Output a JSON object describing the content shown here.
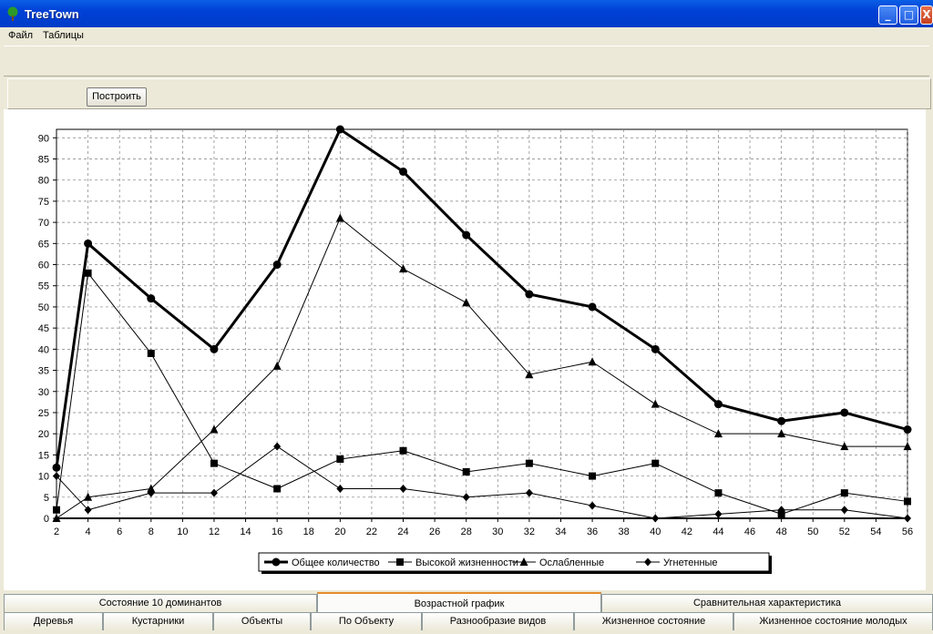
{
  "window": {
    "title": "TreeTown"
  },
  "menu": [
    "Файл",
    "Таблицы"
  ],
  "toolbar": {
    "build_label": "Построить"
  },
  "tabs_row1": [
    "Состояние 10 доминантов",
    "Возрастной график",
    "Сравнительная характеристика"
  ],
  "tabs_row2": [
    "Деревья",
    "Кустарники",
    "Объекты",
    "По Объекту",
    "Разнообразие видов",
    "Жизненное состояние",
    "Жизненное состояние молодых"
  ],
  "active_tab_row1": "Возрастной график",
  "chart_data": {
    "type": "line",
    "x": [
      2,
      4,
      8,
      12,
      16,
      20,
      24,
      28,
      32,
      36,
      40,
      44,
      48,
      52,
      56
    ],
    "x_ticks": [
      2,
      4,
      6,
      8,
      10,
      12,
      14,
      16,
      18,
      20,
      22,
      24,
      26,
      28,
      30,
      32,
      34,
      36,
      38,
      40,
      42,
      44,
      46,
      48,
      50,
      52,
      54,
      56
    ],
    "y_ticks": [
      0,
      5,
      10,
      15,
      20,
      25,
      30,
      35,
      40,
      45,
      50,
      55,
      60,
      65,
      70,
      75,
      80,
      85,
      90
    ],
    "xlim": [
      2,
      56
    ],
    "ylim": [
      0,
      92
    ],
    "grid": true,
    "legend_position": "bottom-center",
    "series": [
      {
        "name": "Общее количество",
        "marker": "circle",
        "width": 3,
        "values": [
          12,
          65,
          52,
          40,
          60,
          92,
          82,
          67,
          53,
          50,
          40,
          27,
          23,
          25,
          21
        ]
      },
      {
        "name": "Высокой жизненности",
        "marker": "square",
        "width": 1,
        "values": [
          2,
          58,
          39,
          13,
          7,
          14,
          16,
          11,
          13,
          10,
          13,
          6,
          1,
          6,
          4
        ]
      },
      {
        "name": "Ослабленные",
        "marker": "triangle",
        "width": 1,
        "values": [
          0,
          5,
          7,
          21,
          36,
          71,
          59,
          51,
          34,
          37,
          27,
          20,
          20,
          17,
          17
        ]
      },
      {
        "name": "Угнетенные",
        "marker": "diamond",
        "width": 1,
        "values": [
          10,
          2,
          6,
          6,
          17,
          7,
          7,
          5,
          6,
          3,
          0,
          1,
          2,
          2,
          0
        ]
      }
    ],
    "colors": {
      "line": "#000000",
      "grid": "#808080",
      "plot_bg": "#ffffff"
    }
  }
}
